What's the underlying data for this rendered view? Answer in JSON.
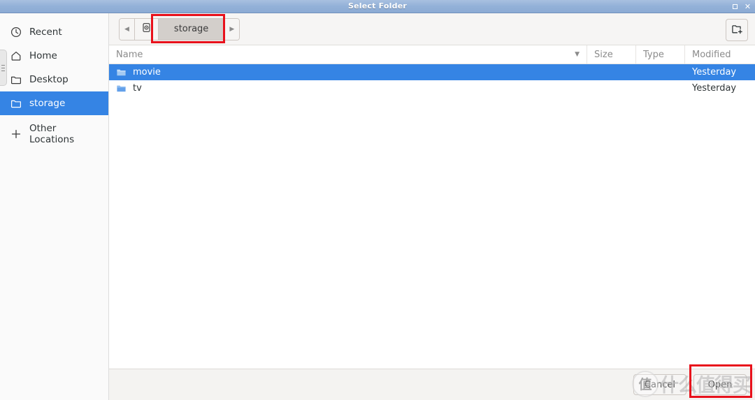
{
  "window": {
    "title": "Select Folder",
    "controls": [
      {
        "name": "restore",
        "glyph": "□"
      },
      {
        "name": "close",
        "glyph": "✕"
      }
    ]
  },
  "sidebar": {
    "items": [
      {
        "label": "Recent",
        "icon": "clock-icon",
        "selected": false
      },
      {
        "label": "Home",
        "icon": "home-icon",
        "selected": false
      },
      {
        "label": "Desktop",
        "icon": "folder-icon",
        "selected": false
      },
      {
        "label": "storage",
        "icon": "folder-icon",
        "selected": true
      },
      {
        "label": "Other Locations",
        "icon": "plus-icon",
        "selected": false
      }
    ]
  },
  "pathbar": {
    "back_glyph": "◀",
    "forward_glyph": "▶",
    "device_icon": "drive-icon",
    "current": "storage",
    "new_folder_icon": "create-folder-icon"
  },
  "columns": {
    "name": "Name",
    "size": "Size",
    "type": "Type",
    "modified": "Modified",
    "sort_glyph": "▼"
  },
  "files": [
    {
      "name": "movie",
      "size": "",
      "type": "",
      "modified": "Yesterday",
      "icon": "folder-icon",
      "selected": true
    },
    {
      "name": "tv",
      "size": "",
      "type": "",
      "modified": "Yesterday",
      "icon": "folder-icon",
      "selected": false
    }
  ],
  "actions": {
    "cancel": "Cancel",
    "open": "Open"
  },
  "watermark": {
    "logo_char": "值",
    "text": "什么值得买"
  },
  "colors": {
    "selection_blue": "#3584e4",
    "titlebar_blue": "#93b1d8",
    "annotation_red": "#e8111b",
    "folder_icon": "#62a0ea"
  }
}
